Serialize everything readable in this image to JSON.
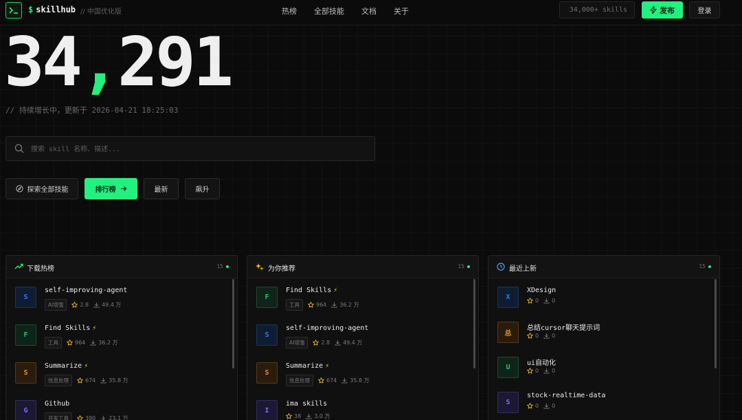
{
  "header": {
    "brand": "skillhub",
    "brand_prefix": "$",
    "tagline": "// 中国优化版",
    "nav": [
      "热榜",
      "全部技能",
      "文档",
      "关于"
    ],
    "skills_count": "34,000+ skills",
    "publish_label": "发布",
    "login_label": "登录"
  },
  "hero": {
    "count_main": "34",
    "count_comma": ",",
    "count_rest": "291",
    "subtitle": "// 持续增长中，更新于 2026-04-21 18:25:03"
  },
  "search": {
    "placeholder": "搜索 skill 名称、描述..."
  },
  "actions": {
    "explore": "探索全部技能",
    "ranking": "排行榜",
    "latest": "最新",
    "rising": "飙升"
  },
  "panels": [
    {
      "title": "下载热榜",
      "count": "15",
      "icon": "trending-up-icon",
      "items": [
        {
          "letter": "S",
          "name": "self-improving-agent",
          "hot": false,
          "tag": "AI增强",
          "stars": "2.8",
          "downloads": "49.4 万"
        },
        {
          "letter": "F",
          "name": "Find Skills",
          "hot": true,
          "tag": "工具",
          "stars": "964",
          "downloads": "36.2 万"
        },
        {
          "letter": "S",
          "name": "Summarize",
          "hot": true,
          "tag": "信息处理",
          "stars": "674",
          "downloads": "35.8 万"
        },
        {
          "letter": "G",
          "name": "Github",
          "hot": false,
          "tag": "开发工具",
          "stars": "390",
          "downloads": "23.1 万"
        }
      ]
    },
    {
      "title": "为你推荐",
      "count": "15",
      "icon": "sparkles-icon",
      "items": [
        {
          "letter": "F",
          "name": "Find Skills",
          "hot": true,
          "tag": "工具",
          "stars": "964",
          "downloads": "36.2 万"
        },
        {
          "letter": "S",
          "name": "self-improving-agent",
          "hot": false,
          "tag": "AI增强",
          "stars": "2.8",
          "downloads": "49.4 万"
        },
        {
          "letter": "S",
          "name": "Summarize",
          "hot": true,
          "tag": "信息处理",
          "stars": "674",
          "downloads": "35.8 万"
        },
        {
          "letter": "I",
          "name": "ima skills",
          "hot": false,
          "tag": "",
          "stars": "38",
          "downloads": "3.0 万"
        }
      ]
    },
    {
      "title": "最近上新",
      "count": "15",
      "icon": "clock-icon",
      "items": [
        {
          "letter": "X",
          "name": "XDesign",
          "hot": false,
          "tag": "",
          "stars": "0",
          "downloads": "0"
        },
        {
          "letter": "总",
          "name": "总结cursor聊天提示词",
          "hot": false,
          "tag": "",
          "stars": "0",
          "downloads": "0"
        },
        {
          "letter": "U",
          "name": "ui自动化",
          "hot": false,
          "tag": "",
          "stars": "0",
          "downloads": "0"
        },
        {
          "letter": "S",
          "name": "stock-realtime-data",
          "hot": false,
          "tag": "",
          "stars": "0",
          "downloads": "0"
        }
      ]
    }
  ],
  "colors": {
    "accent": "#22f07f",
    "bolt": "#f5c518",
    "avatar_blue": "#2f7de1",
    "avatar_green": "#26c26b",
    "avatar_orange": "#e0902a",
    "avatar_purple": "#7b6cf0"
  }
}
